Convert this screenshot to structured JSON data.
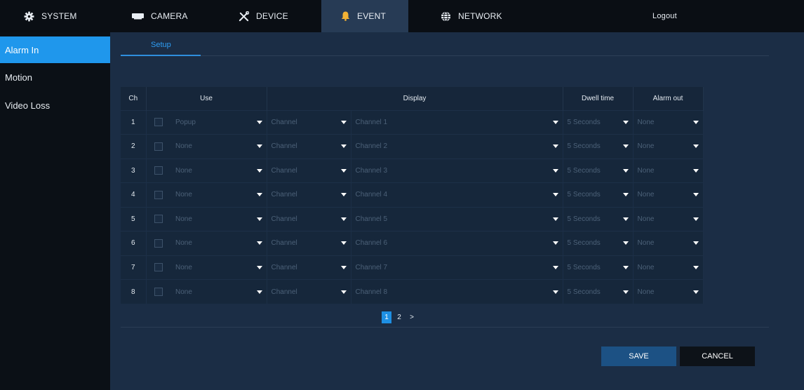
{
  "nav": {
    "tabs": [
      {
        "label": "SYSTEM",
        "icon": "gear-icon"
      },
      {
        "label": "CAMERA",
        "icon": "camera-icon"
      },
      {
        "label": "DEVICE",
        "icon": "tools-icon"
      },
      {
        "label": "EVENT",
        "icon": "bell-icon"
      },
      {
        "label": "NETWORK",
        "icon": "globe-icon"
      }
    ],
    "active": "EVENT",
    "logout": "Logout"
  },
  "sidebar": {
    "items": [
      {
        "label": "Alarm In"
      },
      {
        "label": "Motion"
      },
      {
        "label": "Video Loss"
      }
    ],
    "active": "Alarm In"
  },
  "subtab": {
    "label": "Setup"
  },
  "table": {
    "headers": {
      "ch": "Ch",
      "use": "Use",
      "display": "Display",
      "dwell": "Dwell time",
      "alarm_out": "Alarm out"
    },
    "rows": [
      {
        "ch": "1",
        "use": "Popup",
        "mode": "Channel",
        "channel": "Channel 1",
        "dwell": "5 Seconds",
        "alarm_out": "None"
      },
      {
        "ch": "2",
        "use": "None",
        "mode": "Channel",
        "channel": "Channel 2",
        "dwell": "5 Seconds",
        "alarm_out": "None"
      },
      {
        "ch": "3",
        "use": "None",
        "mode": "Channel",
        "channel": "Channel 3",
        "dwell": "5 Seconds",
        "alarm_out": "None"
      },
      {
        "ch": "4",
        "use": "None",
        "mode": "Channel",
        "channel": "Channel 4",
        "dwell": "5 Seconds",
        "alarm_out": "None"
      },
      {
        "ch": "5",
        "use": "None",
        "mode": "Channel",
        "channel": "Channel 5",
        "dwell": "5 Seconds",
        "alarm_out": "None"
      },
      {
        "ch": "6",
        "use": "None",
        "mode": "Channel",
        "channel": "Channel 6",
        "dwell": "5 Seconds",
        "alarm_out": "None"
      },
      {
        "ch": "7",
        "use": "None",
        "mode": "Channel",
        "channel": "Channel 7",
        "dwell": "5 Seconds",
        "alarm_out": "None"
      },
      {
        "ch": "8",
        "use": "None",
        "mode": "Channel",
        "channel": "Channel 8",
        "dwell": "5 Seconds",
        "alarm_out": "None"
      }
    ]
  },
  "pagination": {
    "pages": [
      "1",
      "2"
    ],
    "current": "1",
    "next": ">"
  },
  "buttons": {
    "save": "SAVE",
    "cancel": "CANCEL"
  },
  "colors": {
    "accent": "#1f97ec",
    "background": "#1b2d45",
    "topbar": "#0a0e14",
    "save_button": "#1c5184"
  }
}
